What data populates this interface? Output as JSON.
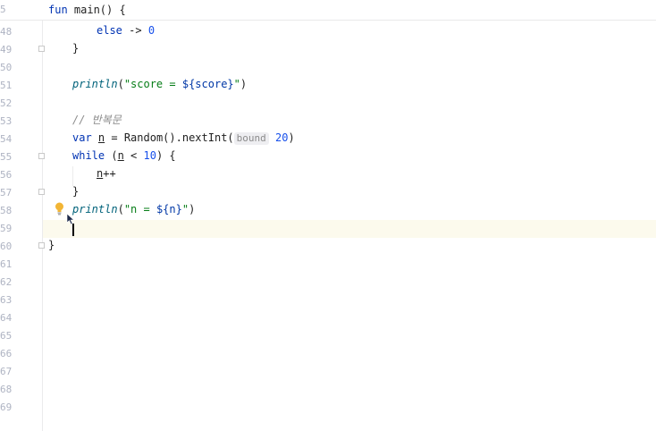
{
  "editor": {
    "sticky": {
      "line_number": "5",
      "code": "fun main() {"
    },
    "gutter_numbers": [
      "48",
      "49",
      "50",
      "51",
      "52",
      "53",
      "54",
      "55",
      "56",
      "57",
      "58",
      "59",
      "60",
      "61",
      "62",
      "63",
      "64",
      "65",
      "66",
      "67",
      "68",
      "69"
    ],
    "lines": {
      "l48_kw": "else",
      "l48_arrow": " -> ",
      "l48_num": "0",
      "l49": "}",
      "l51_fn": "println",
      "l51_open": "(",
      "l51_str1": "\"score = ",
      "l51_tmpl": "${score}",
      "l51_str2": "\"",
      "l51_close": ")",
      "l53_cmt": "// 반복문",
      "l54_kw": "var",
      "l54_var": "n",
      "l54_mid": " = Random().nextInt(",
      "l54_hint": "bound",
      "l54_num": "20",
      "l54_close": ")",
      "l55_kw": "while",
      "l55_open": " (",
      "l55_var": "n",
      "l55_mid": " < ",
      "l55_num": "10",
      "l55_close": ") {",
      "l56_var": "n",
      "l56_op": "++",
      "l57": "}",
      "l58_fn": "println",
      "l58_open": "(",
      "l58_str1": "\"n = ",
      "l58_tmpl": "${n}",
      "l58_str2": "\"",
      "l58_close": ")",
      "l60": "}"
    }
  },
  "colors": {
    "keyword": "#0033b3",
    "function": "#00627a",
    "string": "#067d17",
    "number": "#1750eb",
    "comment": "#8c8c8c",
    "current_line": "#fcfaed",
    "bulb": "#f2b535"
  },
  "icons": {
    "bulb": "lightbulb-icon",
    "fold": "fold-marker-icon",
    "cursor": "mouse-pointer-icon"
  }
}
